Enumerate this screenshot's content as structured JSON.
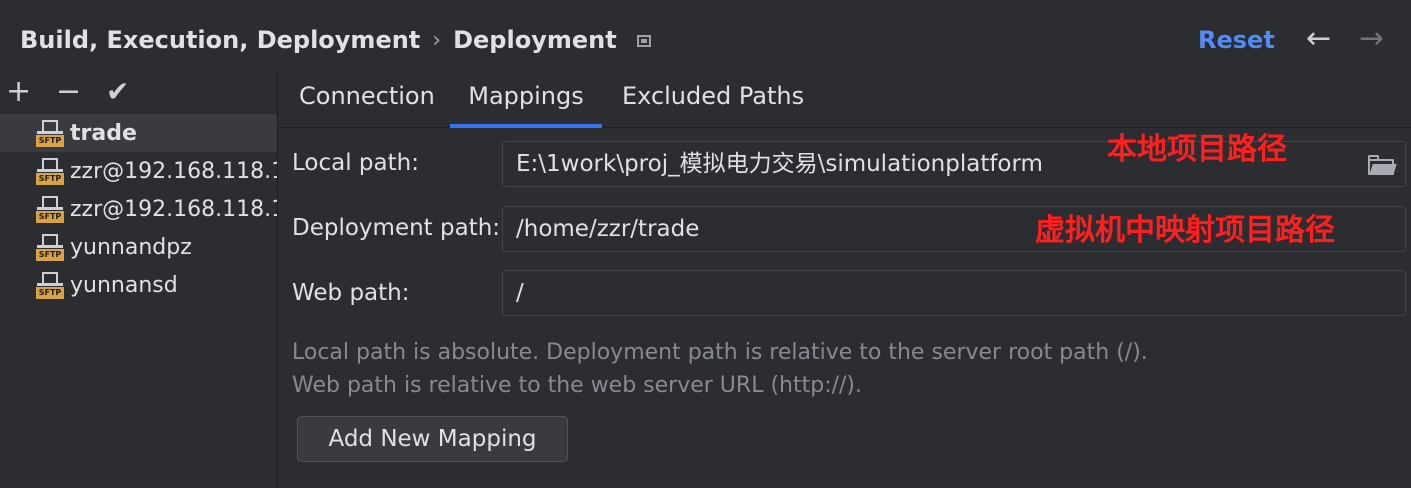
{
  "header": {
    "breadcrumb_parent": "Build, Execution, Deployment",
    "breadcrumb_separator": "›",
    "breadcrumb_current": "Deployment",
    "reset_label": "Reset",
    "back_icon": "←",
    "forward_icon": "→"
  },
  "toolbar": {
    "add_icon": "+",
    "remove_icon": "−",
    "check_icon": "✔"
  },
  "servers": [
    {
      "name": "trade",
      "icon": "sftp-server-icon",
      "icon_label": "SFTP",
      "selected": true
    },
    {
      "name": "zzr@192.168.118.1",
      "icon": "sftp-server-icon",
      "icon_label": "SFTP",
      "selected": false
    },
    {
      "name": "zzr@192.168.118.1",
      "icon": "sftp-server-icon",
      "icon_label": "SFTP",
      "selected": false
    },
    {
      "name": "yunnandpz",
      "icon": "sftp-server-icon",
      "icon_label": "SFTP",
      "selected": false
    },
    {
      "name": "yunnansd",
      "icon": "sftp-server-icon",
      "icon_label": "SFTP",
      "selected": false
    }
  ],
  "tabs": [
    {
      "label": "Connection",
      "active": false
    },
    {
      "label": "Mappings",
      "active": true
    },
    {
      "label": "Excluded Paths",
      "active": false
    }
  ],
  "form": {
    "local_path_label": "Local path:",
    "local_path_value": "E:\\1work\\proj_模拟电力交易\\simulationplatform",
    "deployment_path_label": "Deployment path:",
    "deployment_path_value": "/home/zzr/trade",
    "web_path_label": "Web path:",
    "web_path_value": "/"
  },
  "annotations": {
    "local_note": "本地项目路径",
    "deployment_note": "虚拟机中映射项目路径"
  },
  "hints": {
    "line1": "Local path is absolute. Deployment path is relative to the server root path (/).",
    "line2": "Web path is relative to the web server URL (http://)."
  },
  "add_mapping_label": "Add New Mapping",
  "colors": {
    "background": "#2b2d30",
    "accent": "#548af7",
    "tab_underline": "#3574f0",
    "annotation": "#ff1f1f",
    "sftp_badge": "#d9a343"
  }
}
